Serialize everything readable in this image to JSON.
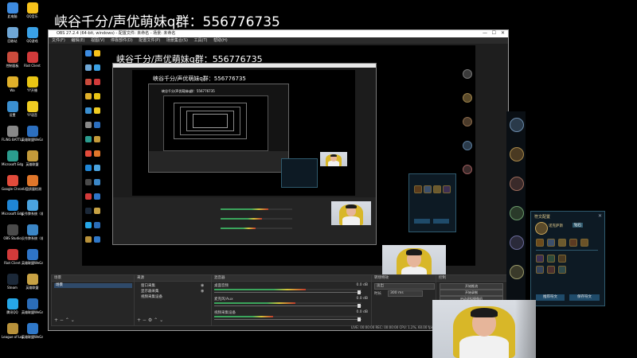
{
  "overlay": {
    "headline": "峡谷千分/声优萌妹q群：556776735",
    "headline_nested": "峡谷千分/声优萌妹q群：556776735",
    "headline_nested2": "峡谷千分/声优萌妹q群：556776735",
    "headline_nested3": "峡谷千分/声优萌妹q群：556776735"
  },
  "desktop_icons": [
    {
      "label": "此电脑",
      "color": "#3d8be0"
    },
    {
      "label": "QQ音乐",
      "color": "#f7c21b"
    },
    {
      "label": "回收站",
      "color": "#6fa7d6"
    },
    {
      "label": "QQ游戏",
      "color": "#3aa1e6"
    },
    {
      "label": "控制面板",
      "color": "#c94b3c"
    },
    {
      "label": "Riot Client",
      "color": "#d23a3a"
    },
    {
      "label": "Wa",
      "color": "#e0b02a"
    },
    {
      "label": "YY开播",
      "color": "#e9c514"
    },
    {
      "label": "设置",
      "color": "#3b8fd0"
    },
    {
      "label": "YY语音",
      "color": "#f0cc22"
    },
    {
      "label": "FLiNG BATTLEGR...",
      "color": "#888888"
    },
    {
      "label": "英雄联盟WeGame版",
      "color": "#2c6fbf"
    },
    {
      "label": "Microsoft Edge",
      "color": "#2b9c8e"
    },
    {
      "label": "英雄联盟",
      "color": "#c49a3a"
    },
    {
      "label": "Google Chrome",
      "color": "#e24b3b"
    },
    {
      "label": "U盘质量检测",
      "color": "#e0762a"
    },
    {
      "label": "Microsoft Edge",
      "color": "#1f86d6"
    },
    {
      "label": "反作弊系统（非游戏）",
      "color": "#4aa3df"
    },
    {
      "label": "OBS Studio",
      "color": "#4a4a4a"
    },
    {
      "label": "反作弊系统（非游戏）",
      "color": "#3b86c6"
    },
    {
      "label": "Riot Client",
      "color": "#d23a3a"
    },
    {
      "label": "英雄联盟WeGame版",
      "color": "#2e74c7"
    },
    {
      "label": "Steam",
      "color": "#1b2838"
    },
    {
      "label": "英雄联盟",
      "color": "#c8a244"
    },
    {
      "label": "腾讯QQ",
      "color": "#26a7e8"
    },
    {
      "label": "英雄联盟WeGame版",
      "color": "#2b6db8"
    },
    {
      "label": "League of Legends",
      "color": "#b8913a"
    },
    {
      "label": "英雄联盟WeGame版",
      "color": "#2f78c9"
    }
  ],
  "obs": {
    "window_title": "OBS 27.2.4 (64-bit, windows) - 配置文件: 未命名 - 场景: 未命名",
    "menu": [
      "文件(F)",
      "编辑(E)",
      "视图(V)",
      "停靠部件(D)",
      "配置文件(P)",
      "场景集合(S)",
      "工具(T)",
      "帮助(H)"
    ],
    "docks": {
      "scenes_title": "场景",
      "sources_title": "来源",
      "mixer_title": "混音器",
      "transitions_title": "转场特效",
      "controls_title": "控制"
    },
    "scene_item": "场景",
    "sources": [
      "窗口采集",
      "显示器采集",
      "视频采集设备"
    ],
    "mixer_tracks": [
      {
        "name": "桌面音频",
        "db": "0.0 dB",
        "level": 0.62
      },
      {
        "name": "麦克风/Aux",
        "db": "0.0 dB",
        "level": 0.55
      },
      {
        "name": "视频采集设备",
        "db": "0.0 dB",
        "level": 0.4
      }
    ],
    "transition": {
      "type": "淡出",
      "duration_label": "时长",
      "duration": "300 ms"
    },
    "controls": [
      "开始推流",
      "开始录制",
      "启动虚拟摄像机",
      "工作室模式",
      "设置",
      "退出"
    ],
    "status": "LIVE: 00:00:00   REC: 00:00:00   CPU: 1.2%, 60.00 fps"
  },
  "game_panel": {
    "title": "符文配置",
    "player": "诺克萨斯",
    "rank_badge": "钻石",
    "buttons": [
      "推荐符文",
      "保存符文"
    ]
  }
}
